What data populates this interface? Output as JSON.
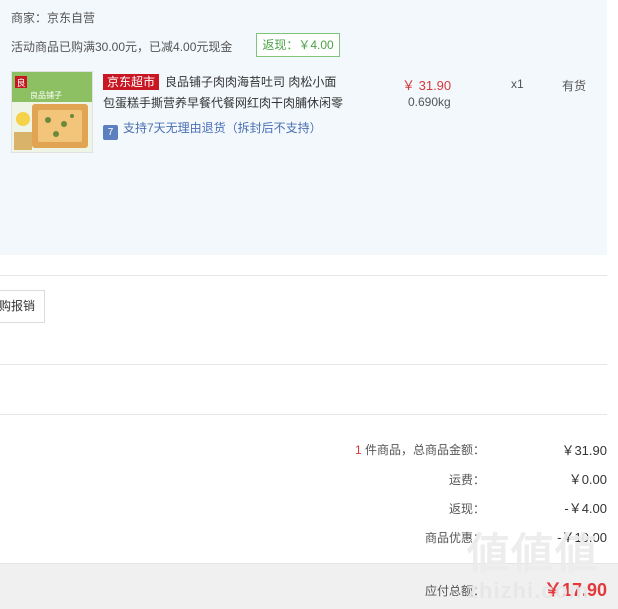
{
  "order": {
    "merchant": "商家：京东自营",
    "promo": "活动商品已购满30.00元，已减4.00元现金",
    "rebate_badge": "返现：￥4.00"
  },
  "product": {
    "tag": "京东超市",
    "title_line1": "良品铺子肉肉海苔吐司 肉松小面",
    "title_line2": "包蛋糕手撕营养早餐代餐网红肉干肉脯休闲零",
    "return_icon_label": "7",
    "return_policy": "支持7天无理由退货（拆封后不支持）",
    "price": "￥ 31.90",
    "weight": "0.690kg",
    "quantity": "x1",
    "stock": "有货",
    "image_brand_text": "良品铺子"
  },
  "invoice": {
    "button_label": "购报销"
  },
  "summary": {
    "count": "1",
    "count_label": " 件商品，总商品金额：",
    "total_value": "￥31.90",
    "shipping_label": "运费：",
    "shipping_value": "￥0.00",
    "rebate_label": "返现：",
    "rebate_value": "-￥4.00",
    "discount_label": "商品优惠：",
    "discount_value": "-￥10.00",
    "pay_label": "应付总额：",
    "pay_value": "￥17.90"
  },
  "watermark": {
    "glyphs": "値値値",
    "text": "zhizhi.com"
  },
  "colors": {
    "panel_bg": "#f3f8fc",
    "accent_red": "#e4393c",
    "jd_red": "#c81623",
    "badge_green": "#4aa347",
    "link_blue": "#4a6fb3"
  }
}
